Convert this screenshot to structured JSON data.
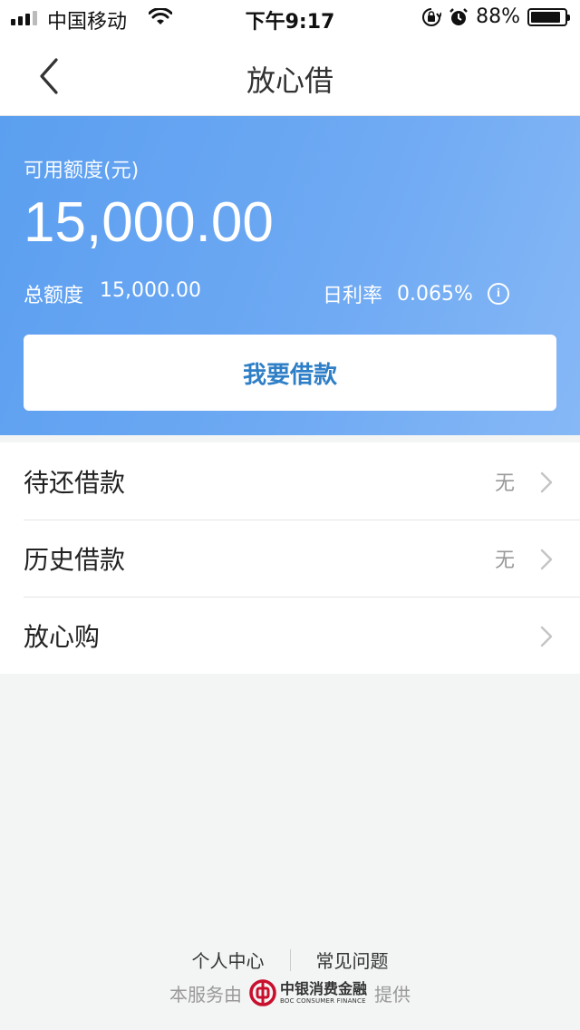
{
  "status_bar": {
    "carrier": "中国移动",
    "time": "下午9:17",
    "battery_percent": "88%",
    "battery_level": 0.88
  },
  "nav": {
    "title": "放心借"
  },
  "hero": {
    "available_label": "可用额度(元)",
    "available_amount": "15,000.00",
    "total_label": "总额度",
    "total_value": "15,000.00",
    "rate_label": "日利率",
    "rate_value": "0.065%",
    "borrow_button": "我要借款"
  },
  "list": {
    "items": [
      {
        "label": "待还借款",
        "value": "无"
      },
      {
        "label": "历史借款",
        "value": "无"
      },
      {
        "label": "放心购",
        "value": ""
      }
    ]
  },
  "footer": {
    "personal_center": "个人中心",
    "faq": "常见问题",
    "provided_by_prefix": "本服务由",
    "provider_name_cn": "中银消费金融",
    "provider_name_en": "BOC CONSUMER FINANCE",
    "provided_by_suffix": "提供"
  },
  "colors": {
    "hero_start": "#5b9ff0",
    "hero_end": "#86b8f6",
    "button_text": "#2f7fc7",
    "boc_red": "#c8102e"
  }
}
